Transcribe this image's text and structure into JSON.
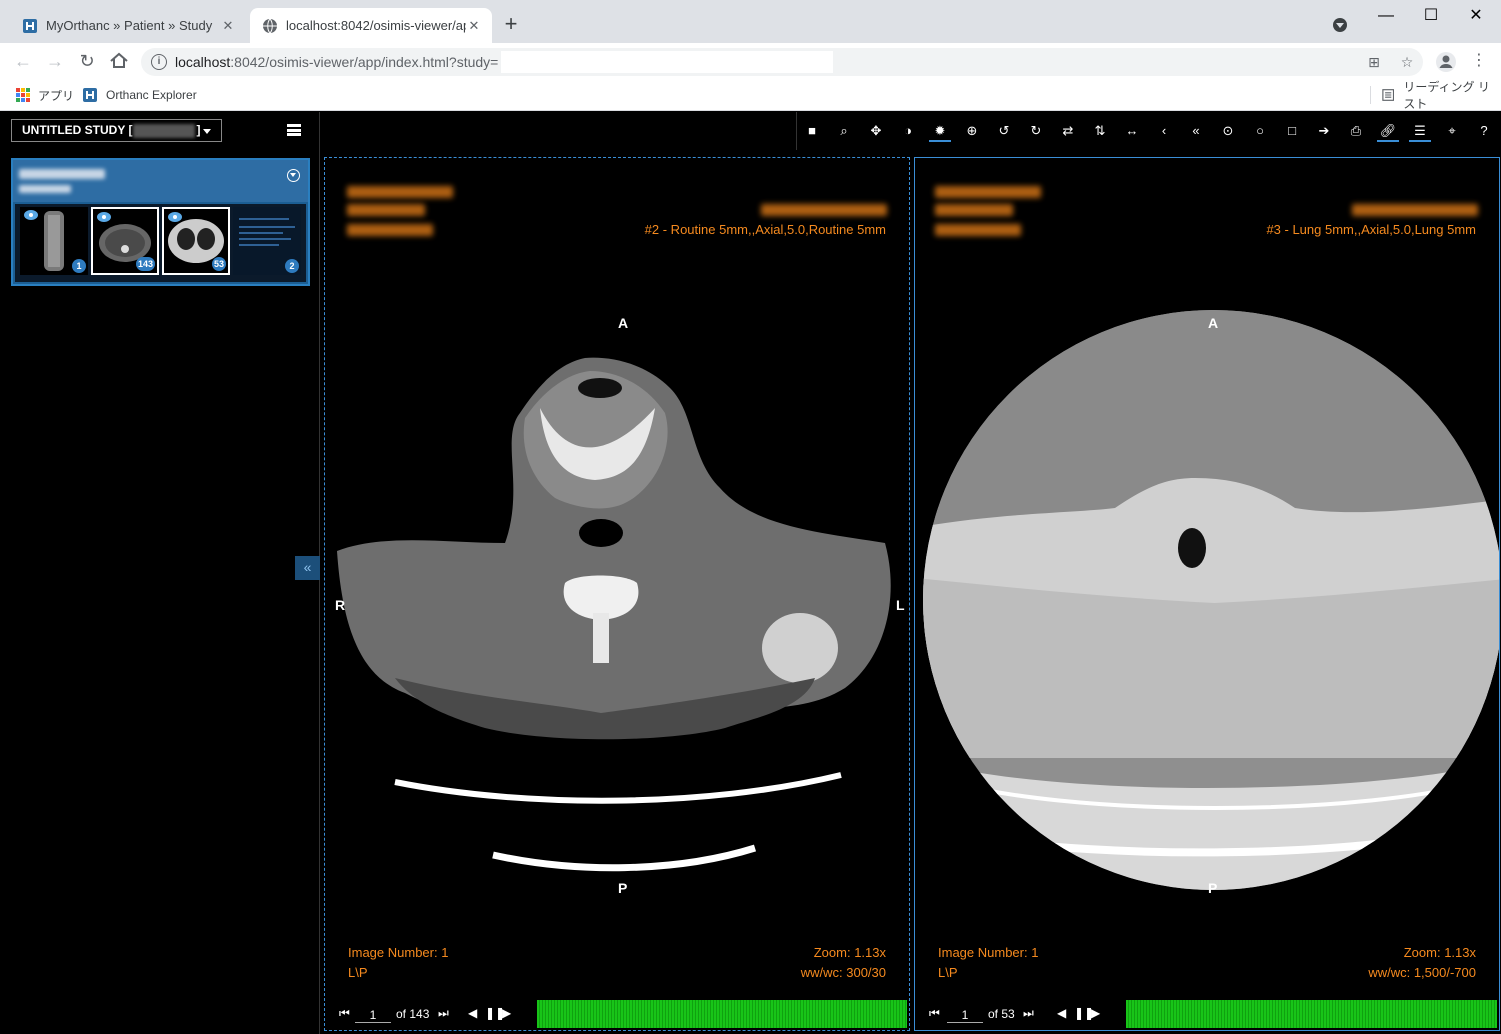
{
  "browser": {
    "tabs": [
      {
        "title": "MyOrthanc » Patient » Study",
        "active": false
      },
      {
        "title": "localhost:8042/osimis-viewer/app/",
        "active": true
      }
    ],
    "url_host": "localhost",
    "url_rest": ":8042/osimis-viewer/app/index.html?study=",
    "bookmarks": [
      {
        "label": "アプリ",
        "icon": "apps-grid-icon"
      },
      {
        "label": "Orthanc Explorer",
        "icon": "orthanc-icon"
      }
    ],
    "reading_list": "リーディング リスト",
    "colors": {
      "tabstrip": "#dee1e6",
      "accent": "#3a8ed6"
    }
  },
  "sidebar": {
    "study_select_prefix": "UNTITLED STUDY [",
    "study_select_suffix": "]",
    "thumbnails": [
      {
        "count": "1",
        "selected": false
      },
      {
        "count": "143",
        "selected": true
      },
      {
        "count": "53",
        "selected": true
      },
      {
        "count": "2",
        "selected": false
      }
    ]
  },
  "toolbar_icons": [
    "stop-icon",
    "zoom-icon",
    "pan-icon",
    "contrast-icon",
    "windowing-icon",
    "magnify-icon",
    "rotate-left-icon",
    "rotate-right-icon",
    "flip-horizontal-icon",
    "flip-vertical-icon",
    "measure-length-icon",
    "previous-icon",
    "first-icon",
    "point-icon",
    "ellipse-icon",
    "rectangle-icon",
    "arrow-icon",
    "print-icon",
    "link-icon",
    "layout-icon",
    "crosshair-icon",
    "help-icon"
  ],
  "viewports": [
    {
      "series_label": "#2 - Routine 5mm,,Axial,5.0,Routine 5mm",
      "orientation": {
        "top": "A",
        "bottom": "P",
        "left": "R",
        "right": "L"
      },
      "image_number": "Image Number: 1",
      "position": "L\\P",
      "zoom": "Zoom: 1.13x",
      "wwwc": "ww/wc: 300/30",
      "slice_current": "1",
      "slice_total": "of 143"
    },
    {
      "series_label": "#3 - Lung 5mm,,Axial,5.0,Lung 5mm",
      "orientation": {
        "top": "A",
        "bottom": "P"
      },
      "image_number": "Image Number: 1",
      "position": "L\\P",
      "zoom": "Zoom: 1.13x",
      "wwwc": "ww/wc: 1,500/-700",
      "slice_current": "1",
      "slice_total": "of 53"
    }
  ]
}
